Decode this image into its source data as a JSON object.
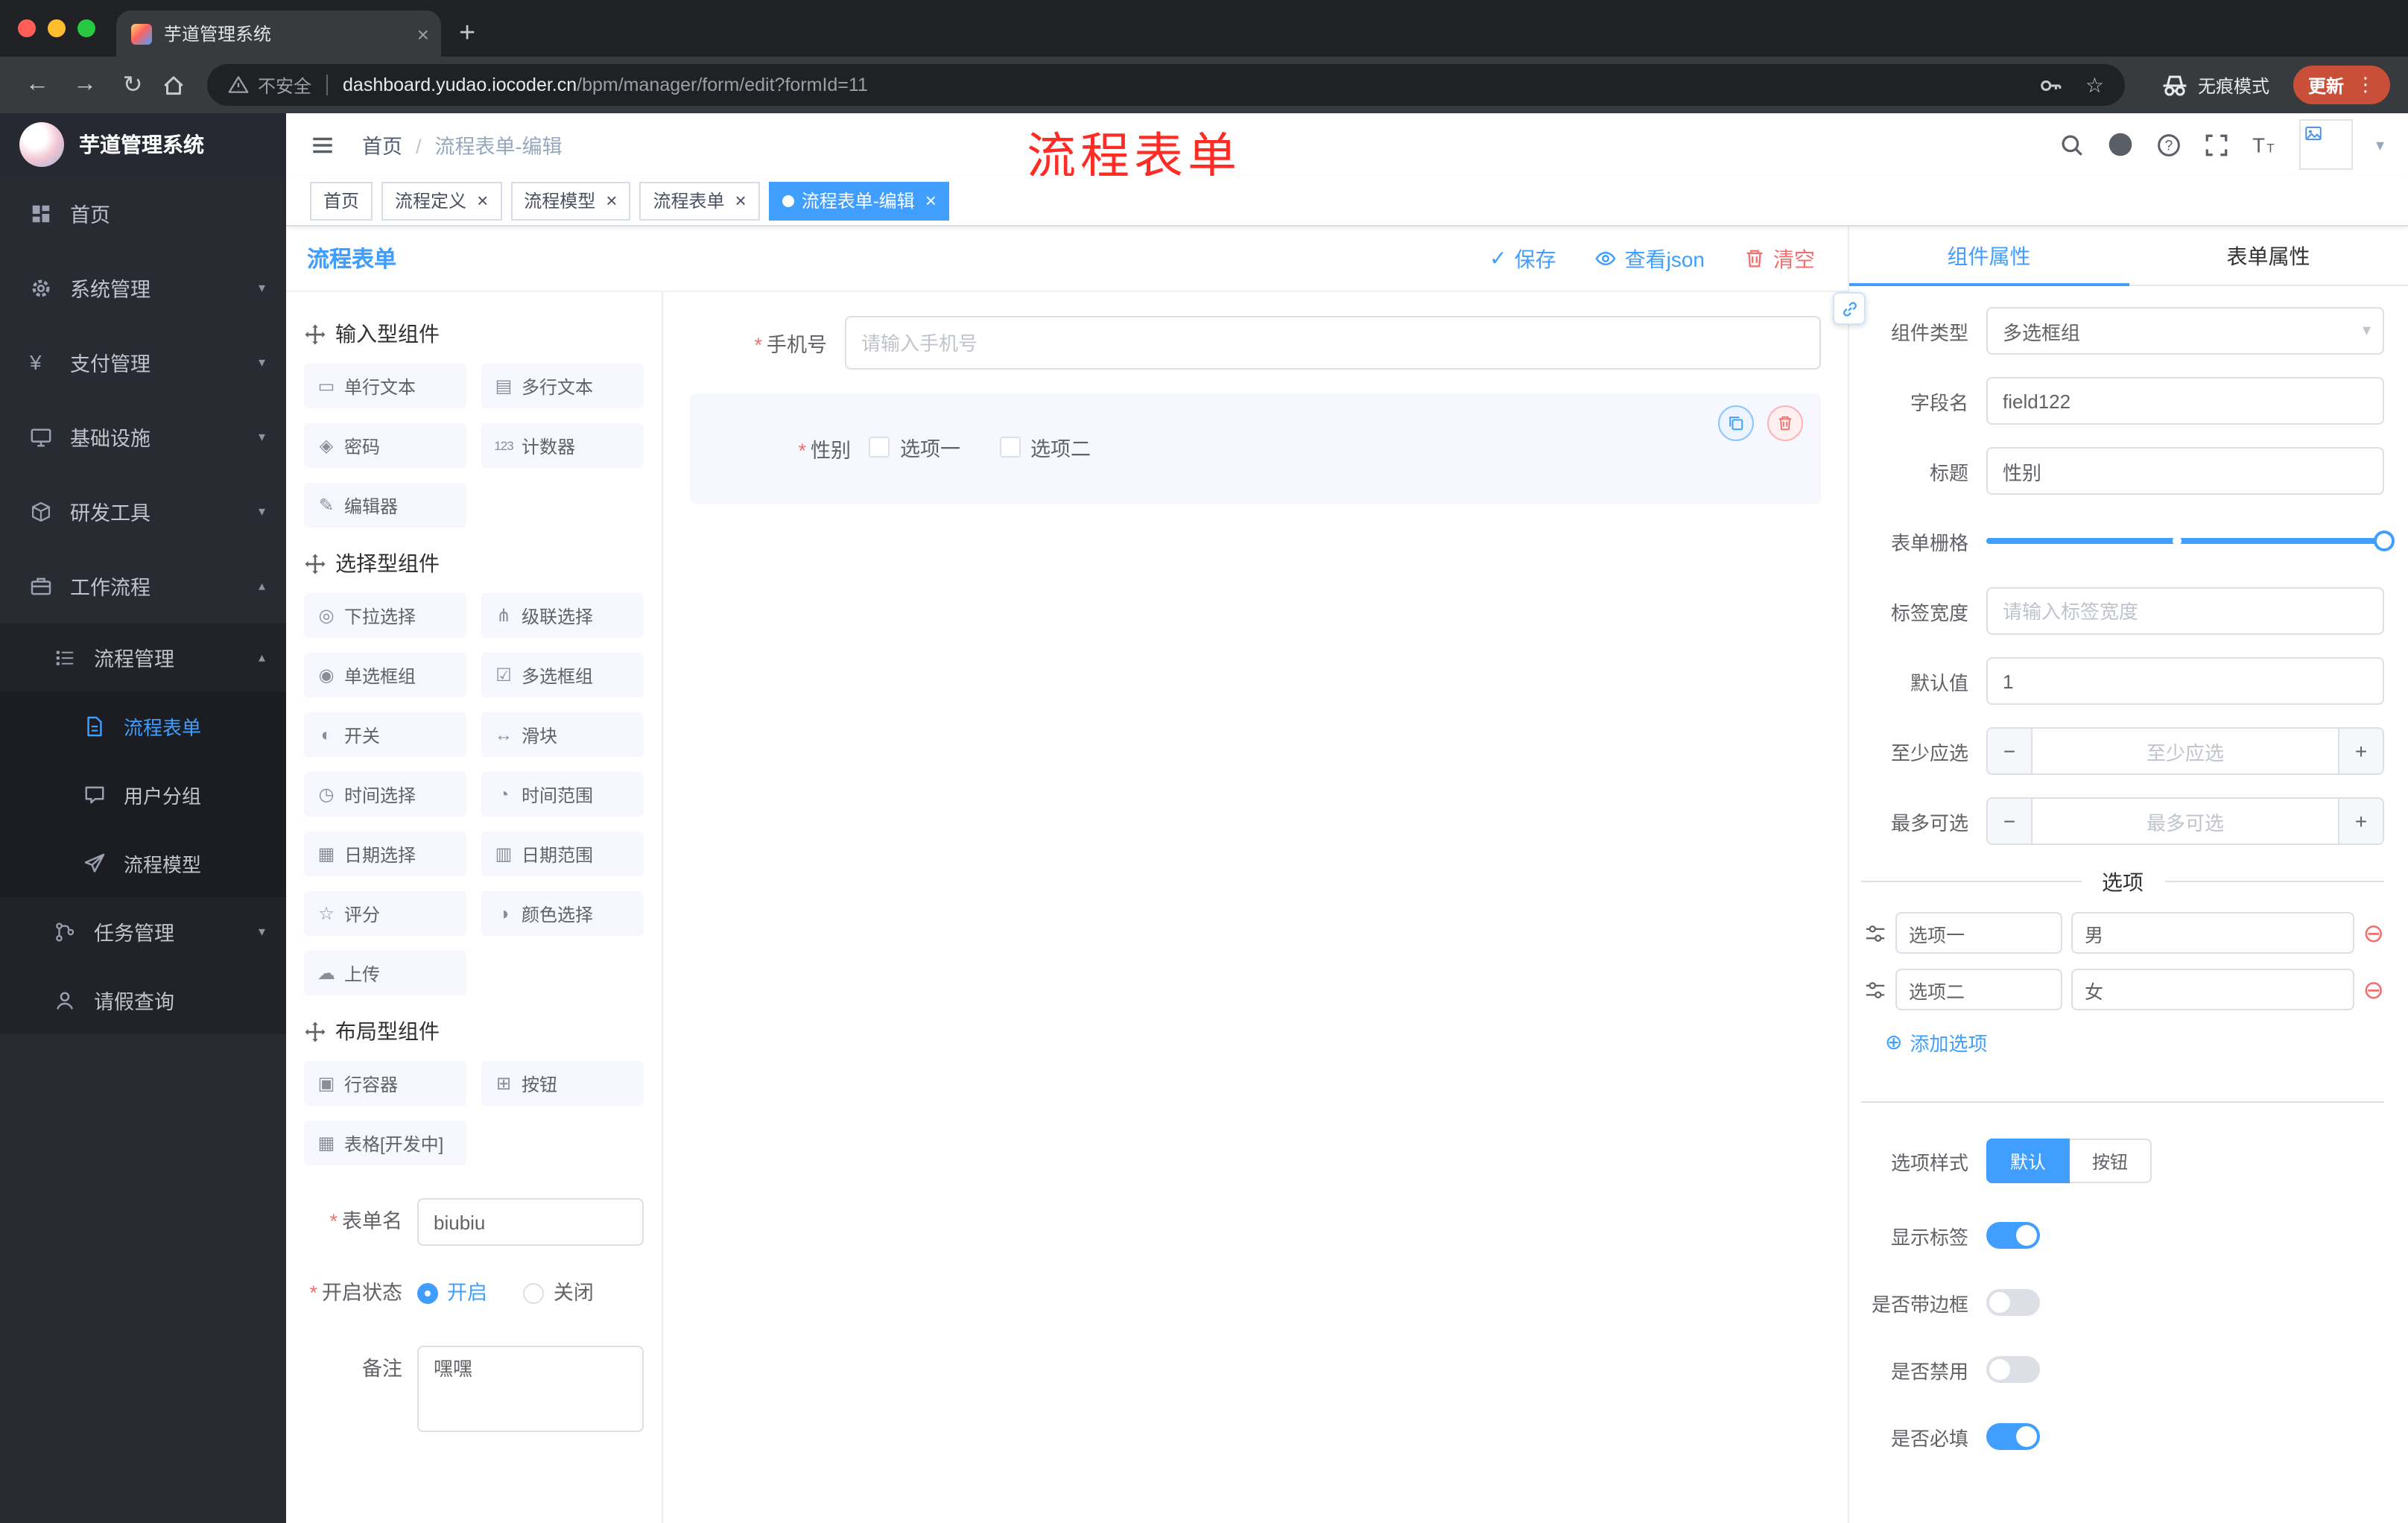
{
  "browser": {
    "tab_title": "芋道管理系统",
    "address": {
      "security": "不安全",
      "domain": "dashboard.yudao.iocoder.cn",
      "path": "/bp​m/manager/form/edit?formId=11"
    },
    "incognito": "无痕模式",
    "update": "更新"
  },
  "annotation": "流程表单",
  "sidebar": {
    "title": "芋道管理系统",
    "items": [
      {
        "label": "首页",
        "icon": "dashboard-icon"
      },
      {
        "label": "系统管理",
        "icon": "gear-icon",
        "arrow": "down"
      },
      {
        "label": "支付管理",
        "icon": "yen-icon",
        "arrow": "down"
      },
      {
        "label": "基础设施",
        "icon": "monitor-icon",
        "arrow": "down"
      },
      {
        "label": "研发工具",
        "icon": "cube-icon",
        "arrow": "down"
      },
      {
        "label": "工作流程",
        "icon": "briefcase-icon",
        "arrow": "up"
      },
      {
        "label": "流程管理",
        "icon": "list-icon",
        "arrow": "up",
        "level": 1
      },
      {
        "label": "流程表单",
        "icon": "document-icon",
        "level": 2,
        "active": true
      },
      {
        "label": "用户分组",
        "icon": "chat-icon",
        "level": 2
      },
      {
        "label": "流程模型",
        "icon": "send-icon",
        "level": 2
      },
      {
        "label": "任务管理",
        "icon": "branch-icon",
        "arrow": "down",
        "level": 1
      },
      {
        "label": "请假查询",
        "icon": "user-icon",
        "level": 1
      }
    ]
  },
  "header": {
    "breadcrumb": [
      "首页",
      "流程表单-编辑"
    ]
  },
  "tags": [
    {
      "label": "首页",
      "closable": false,
      "active": false
    },
    {
      "label": "流程定义",
      "closable": true,
      "active": false
    },
    {
      "label": "流程模型",
      "closable": true,
      "active": false
    },
    {
      "label": "流程表单",
      "closable": true,
      "active": false
    },
    {
      "label": "流程表单-编辑",
      "closable": true,
      "active": true
    }
  ],
  "designer": {
    "title": "流程表单",
    "save": "保存",
    "view_json": "查看json",
    "clear": "清空",
    "groups": [
      {
        "title": "输入型组件",
        "items": [
          {
            "label": "单行文本",
            "icon": "input-icon"
          },
          {
            "label": "多行文本",
            "icon": "textarea-icon"
          },
          {
            "label": "密码",
            "icon": "password-icon"
          },
          {
            "label": "计数器",
            "icon": "counter-icon"
          },
          {
            "label": "编辑器",
            "icon": "editor-icon"
          }
        ]
      },
      {
        "title": "选择型组件",
        "items": [
          {
            "label": "下拉选择",
            "icon": "select-icon"
          },
          {
            "label": "级联选择",
            "icon": "cascader-icon"
          },
          {
            "label": "单选框组",
            "icon": "radio-icon"
          },
          {
            "label": "多选框组",
            "icon": "checkbox-icon"
          },
          {
            "label": "开关",
            "icon": "switch-icon"
          },
          {
            "label": "滑块",
            "icon": "slider-icon"
          },
          {
            "label": "时间选择",
            "icon": "time-icon"
          },
          {
            "label": "时间范围",
            "icon": "time-range-icon"
          },
          {
            "label": "日期选择",
            "icon": "date-icon"
          },
          {
            "label": "日期范围",
            "icon": "date-range-icon"
          },
          {
            "label": "评分",
            "icon": "rate-icon"
          },
          {
            "label": "颜色选择",
            "icon": "color-icon"
          },
          {
            "label": "上传",
            "icon": "upload-icon"
          }
        ]
      },
      {
        "title": "布局型组件",
        "items": [
          {
            "label": "行容器",
            "icon": "row-icon"
          },
          {
            "label": "按钮",
            "icon": "button-icon"
          },
          {
            "label": "表格[开发中]",
            "icon": "table-icon"
          }
        ]
      }
    ],
    "meta": {
      "form_name_label": "表单名",
      "form_name_value": "biubiu",
      "status_label": "开启状态",
      "status_on": "开启",
      "status_off": "关闭",
      "remark_label": "备注",
      "remark_value": "嘿嘿"
    }
  },
  "canvas": {
    "phone": {
      "label": "手机号",
      "placeholder": "请输入手机号"
    },
    "gender": {
      "label": "性别",
      "options": [
        "选项一",
        "选项二"
      ]
    }
  },
  "props": {
    "tabs": [
      "组件属性",
      "表单属性"
    ],
    "component_type": {
      "label": "组件类型",
      "value": "多选框组"
    },
    "field_name": {
      "label": "字段名",
      "value": "field122"
    },
    "title": {
      "label": "标题",
      "value": "性别"
    },
    "grid": {
      "label": "表单栅格",
      "value": 24,
      "max": 24
    },
    "label_width": {
      "label": "标签宽度",
      "placeholder": "请输入标签宽度"
    },
    "default_value": {
      "label": "默认值",
      "value": "1"
    },
    "min_select": {
      "label": "至少应选",
      "placeholder": "至少应选"
    },
    "max_select": {
      "label": "最多可选",
      "placeholder": "最多可选"
    },
    "options_title": "选项",
    "options": [
      {
        "label": "选项一",
        "value": "男"
      },
      {
        "label": "选项二",
        "value": "女"
      }
    ],
    "add_option": "添加选项",
    "option_style": {
      "label": "选项样式",
      "choices": [
        "默认",
        "按钮"
      ],
      "selected": "默认"
    },
    "switches": [
      {
        "label": "显示标签",
        "on": true
      },
      {
        "label": "是否带边框",
        "on": false
      },
      {
        "label": "是否禁用",
        "on": false
      },
      {
        "label": "是否必填",
        "on": true
      }
    ]
  },
  "colors": {
    "primary": "#409EFF",
    "danger": "#F56C6C",
    "annotation": "#FE2C24",
    "active_tag": "#409EFF"
  }
}
